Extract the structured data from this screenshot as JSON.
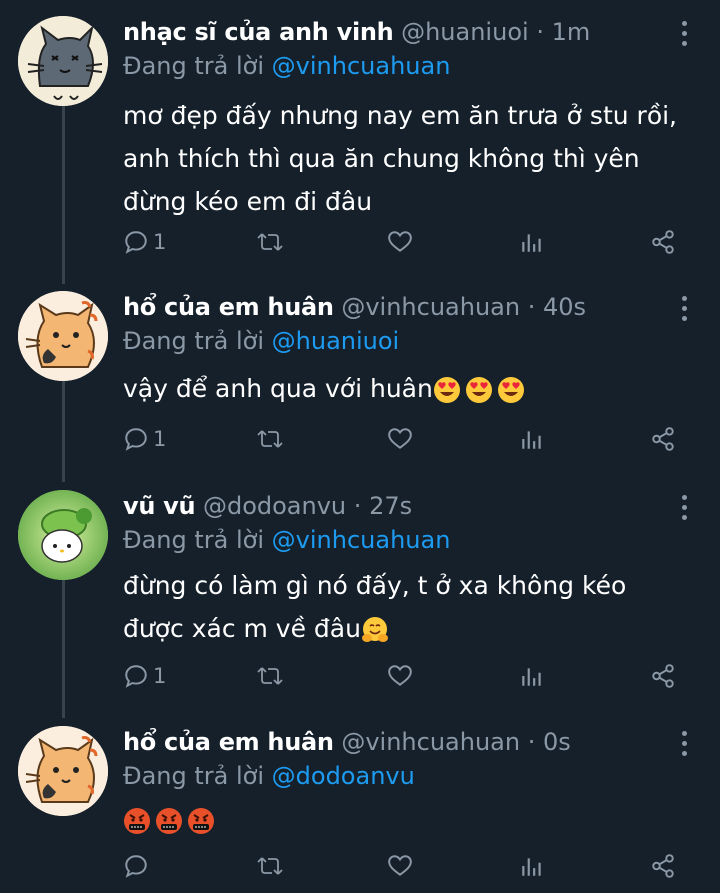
{
  "tweets": [
    {
      "name": "nhạc sĩ của anh vinh",
      "handle": "@huaniuoi",
      "time": "1m",
      "replying_prefix": "Đang trả lời",
      "replying_to": "@vinhcuahuan",
      "text": "mơ đẹp đấy nhưng nay em ăn trưa ở stu rồi, anh thích thì qua ăn chung không thì yên đừng kéo em đi đâu",
      "emojis": [],
      "reply_count": "1",
      "avatar": "gray-cat-avatar"
    },
    {
      "name": "hổ của em huân",
      "handle": "@vinhcuahuan",
      "time": "40s",
      "replying_prefix": "Đang trả lời",
      "replying_to": "@huaniuoi",
      "text": "vậy để anh qua với huân",
      "emojis": [
        "heart-eyes",
        "heart-eyes",
        "heart-eyes"
      ],
      "reply_count": "1",
      "avatar": "orange-cat-avatar"
    },
    {
      "name": "vũ vũ",
      "handle": "@dodoanvu",
      "time": "27s",
      "replying_prefix": "Đang trả lời",
      "replying_to": "@vinhcuahuan",
      "text": "đừng có làm gì nó đấy, t ở xa không kéo được xác m về đâu",
      "emojis": [
        "hugging"
      ],
      "reply_count": "1",
      "avatar": "green-kitty-avatar"
    },
    {
      "name": "hổ của em huân",
      "handle": "@vinhcuahuan",
      "time": "0s",
      "replying_prefix": "Đang trả lời",
      "replying_to": "@dodoanvu",
      "text": "",
      "emojis": [
        "cursing",
        "cursing",
        "cursing"
      ],
      "reply_count": "",
      "avatar": "orange-cat-avatar"
    }
  ],
  "separator": "·",
  "colors": {
    "background": "#15202b",
    "text": "#ffffff",
    "muted": "#8b98a5",
    "accent": "#1d9bf0",
    "thread_line": "#38444d"
  }
}
